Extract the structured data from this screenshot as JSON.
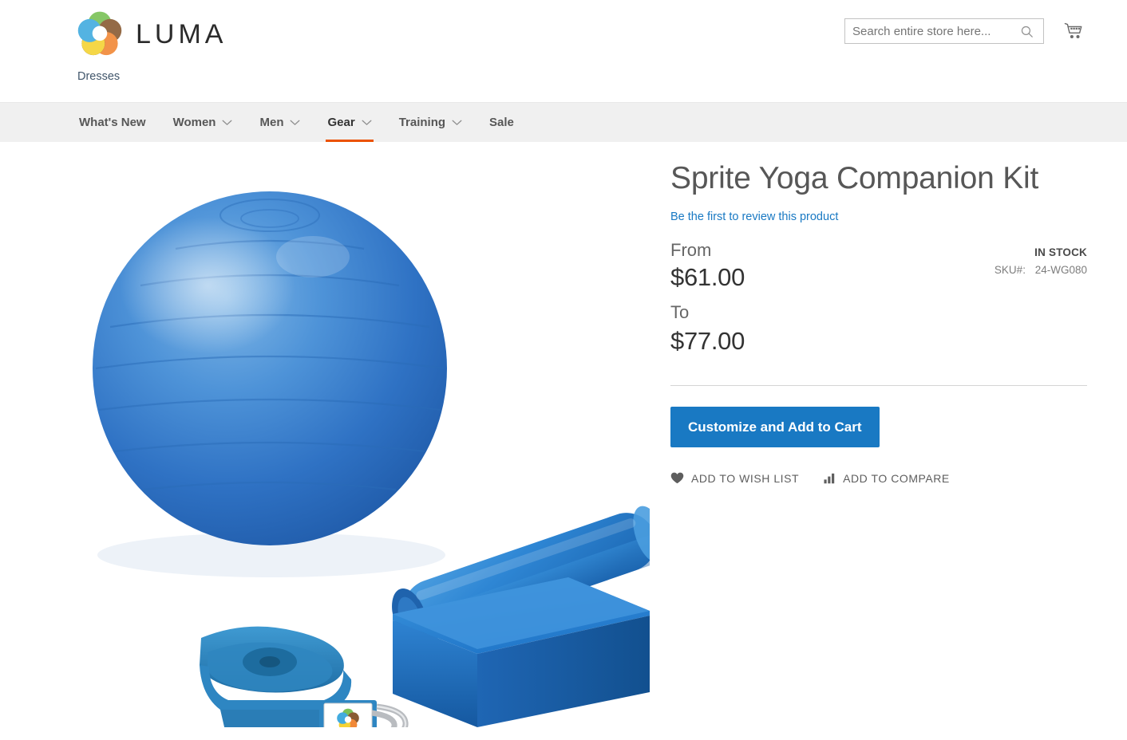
{
  "brand": {
    "name": "LUMA",
    "logo_icon": "luma-rings-logo"
  },
  "header": {
    "breadcrumb": "Dresses",
    "search": {
      "placeholder": "Search entire store here...",
      "value": "",
      "icon": "search-icon"
    },
    "cart": {
      "icon": "shopping-cart-icon"
    }
  },
  "nav": {
    "items": [
      {
        "label": "What's New",
        "has_dropdown": false,
        "active": false
      },
      {
        "label": "Women",
        "has_dropdown": true,
        "active": false
      },
      {
        "label": "Men",
        "has_dropdown": true,
        "active": false
      },
      {
        "label": "Gear",
        "has_dropdown": true,
        "active": true
      },
      {
        "label": "Training",
        "has_dropdown": true,
        "active": false
      },
      {
        "label": "Sale",
        "has_dropdown": false,
        "active": false
      }
    ],
    "active_indicator_color": "#eb5202"
  },
  "product": {
    "title": "Sprite Yoga Companion Kit",
    "review_link": "Be the first to review this product",
    "price": {
      "from_label": "From",
      "from_value": "$61.00",
      "to_label": "To",
      "to_value": "$77.00"
    },
    "stock_status": "IN STOCK",
    "sku_label": "SKU#:",
    "sku_value": "24-WG080",
    "cta_label": "Customize and Add to Cart",
    "actions": [
      {
        "label": "ADD TO WISH LIST",
        "icon": "heart-icon"
      },
      {
        "label": "ADD TO COMPARE",
        "icon": "compare-bars-icon"
      }
    ],
    "image_alt": "Yoga kit with blue exercise ball, foam roller, foam block and teal yoga strap"
  },
  "colors": {
    "primary_button": "#1979c3",
    "link": "#1979c3",
    "active_nav": "#eb5202",
    "nav_background": "#f0f0f0"
  }
}
